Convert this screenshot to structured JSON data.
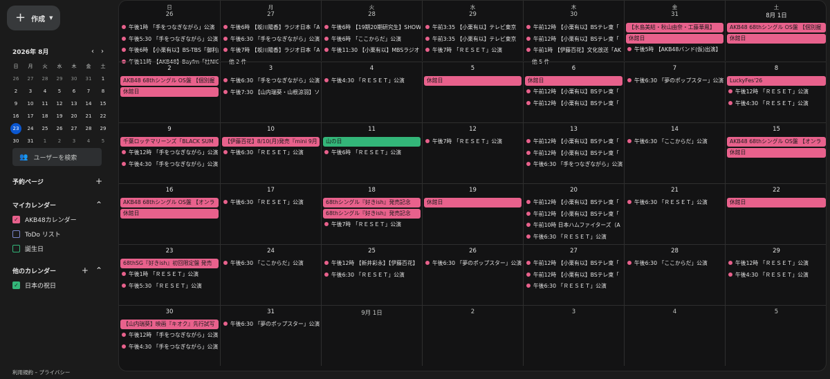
{
  "sidebar": {
    "create_label": "作成",
    "mini_title": "2026年 8月",
    "dow": [
      "日",
      "月",
      "火",
      "水",
      "木",
      "金",
      "土"
    ],
    "mini_days": [
      [
        "26",
        "27",
        "28",
        "29",
        "30",
        "31",
        "1"
      ],
      [
        "2",
        "3",
        "4",
        "5",
        "6",
        "7",
        "8"
      ],
      [
        "9",
        "10",
        "11",
        "12",
        "13",
        "14",
        "15"
      ],
      [
        "16",
        "17",
        "18",
        "19",
        "20",
        "21",
        "22"
      ],
      [
        "23",
        "24",
        "25",
        "26",
        "27",
        "28",
        "29"
      ],
      [
        "30",
        "31",
        "1",
        "2",
        "3",
        "4",
        "5"
      ]
    ],
    "search_users": "ユーザーを検索",
    "booking_pages": "予約ページ",
    "my_calendars": "マイカレンダー",
    "my_items": [
      {
        "label": "AKB48カレンダー",
        "color": "#e8618c",
        "checked": true
      },
      {
        "label": "ToDo リスト",
        "color": "#7986cb",
        "checked": false
      },
      {
        "label": "誕生日",
        "color": "#33b679",
        "checked": false
      }
    ],
    "other_calendars": "他のカレンダー",
    "other_items": [
      {
        "label": "日本の祝日",
        "color": "#33b679",
        "checked": true
      }
    ],
    "footer": "利用規約 – プライバシー"
  },
  "calendar": {
    "dow": [
      "日",
      "月",
      "火",
      "水",
      "木",
      "金",
      "土"
    ],
    "weeks": [
      [
        {
          "day": "26",
          "other": true,
          "events": [
            {
              "t": "timed",
              "text": "午後1時 「手をつなぎながら」公演"
            },
            {
              "t": "timed",
              "text": "午後5:30 「手をつなぎながら」公演"
            },
            {
              "t": "timed",
              "text": "午後6時 【小栗有以】BS-TBS「御利益"
            },
            {
              "t": "timed",
              "text": "午後11時 【AKB48】Bayfm「柱NIGHT"
            }
          ]
        },
        {
          "day": "27",
          "other": true,
          "events": [
            {
              "t": "timed",
              "text": "午後6時 【坂川陽香】ラジオ日本「AK"
            },
            {
              "t": "timed",
              "text": "午後6:30 「手をつなぎながら」公演"
            },
            {
              "t": "timed",
              "text": "午後7時 【坂川陽香】ラジオ日本「AKB"
            },
            {
              "t": "more",
              "text": "他 2 件"
            }
          ]
        },
        {
          "day": "28",
          "other": true,
          "events": [
            {
              "t": "timed",
              "text": "午後6時 【19期20期研究生】SHOW"
            },
            {
              "t": "timed",
              "text": "午後6時 「ここからだ」公演"
            },
            {
              "t": "timed",
              "text": "午後11:30 【小栗有以】MBSラジオ"
            }
          ]
        },
        {
          "day": "29",
          "other": true,
          "events": [
            {
              "t": "timed",
              "text": "午前3:35 【小栗有以】テレビ東京"
            },
            {
              "t": "timed",
              "text": "午前3:35 【小栗有以】テレビ東京"
            },
            {
              "t": "timed",
              "text": "午後7時 「ＲＥＳＥＴ」公演"
            }
          ]
        },
        {
          "day": "30",
          "other": true,
          "events": [
            {
              "t": "timed",
              "text": "午前12時 【小栗有以】BSテレ東「"
            },
            {
              "t": "timed",
              "text": "午前12時 【小栗有以】BSテレ東「"
            },
            {
              "t": "timed",
              "text": "午前1時 【伊藤百花】文化放送「AK"
            },
            {
              "t": "more",
              "text": "他 5 件"
            }
          ]
        },
        {
          "day": "31",
          "other": true,
          "events": [
            {
              "t": "allday",
              "text": "【水島美結・秋山由奈・工藤華鳳】"
            },
            {
              "t": "allday",
              "text": "休館日"
            },
            {
              "t": "timed",
              "text": "午後5時 【AKB48バンド(仮)出演】"
            }
          ]
        },
        {
          "day": "8月 1日",
          "other": false,
          "events": [
            {
              "t": "allday",
              "text": "AKB48 68thシングル OS盤 【個別握"
            },
            {
              "t": "allday",
              "text": "休館日"
            }
          ]
        }
      ],
      [
        {
          "day": "2",
          "events": [
            {
              "t": "allday",
              "text": "AKB48 68thシングル OS盤 【個別握"
            },
            {
              "t": "allday",
              "text": "休館日"
            }
          ]
        },
        {
          "day": "3",
          "events": [
            {
              "t": "timed",
              "text": "午後6:30 「手をつなぎながら」公演"
            },
            {
              "t": "timed",
              "text": "午後7:30 【山内瑞葵・山根涼羽】ソ"
            }
          ]
        },
        {
          "day": "4",
          "events": [
            {
              "t": "timed",
              "text": "午後4:30 「ＲＥＳＥＴ」公演"
            }
          ]
        },
        {
          "day": "5",
          "events": [
            {
              "t": "allday",
              "text": "休館日"
            }
          ]
        },
        {
          "day": "6",
          "events": [
            {
              "t": "allday",
              "text": "休館日"
            },
            {
              "t": "timed",
              "text": "午前12時 【小栗有以】BSテレ東「"
            },
            {
              "t": "timed",
              "text": "午前12時 【小栗有以】BSテレ東「"
            }
          ]
        },
        {
          "day": "7",
          "events": [
            {
              "t": "timed",
              "text": "午後6:30 「夢のポップスター」公演"
            }
          ]
        },
        {
          "day": "8",
          "events": [
            {
              "t": "allday",
              "text": "LuckyFes'26"
            },
            {
              "t": "timed",
              "text": "午後12時 「ＲＥＳＥＴ」公演"
            },
            {
              "t": "timed",
              "text": "午後4:30 「ＲＥＳＥＴ」公演"
            }
          ]
        }
      ],
      [
        {
          "day": "9",
          "events": [
            {
              "t": "allday",
              "text": "千葉ロッテマリーンズ「BLACK SUM"
            },
            {
              "t": "timed",
              "text": "午後12時 「手をつなぎながら」公演"
            },
            {
              "t": "timed",
              "text": "午後4:30 「手をつなぎながら」公演"
            }
          ]
        },
        {
          "day": "10",
          "events": [
            {
              "t": "allday",
              "text": "【伊藤百花】8/10(月)発売『mini 9月"
            },
            {
              "t": "timed",
              "text": "午後6:30 「ＲＥＳＥＴ」公演"
            }
          ]
        },
        {
          "day": "11",
          "events": [
            {
              "t": "allday_green",
              "text": "山の日"
            },
            {
              "t": "timed",
              "text": "午後6時 「ＲＥＳＥＴ」公演"
            }
          ]
        },
        {
          "day": "12",
          "events": [
            {
              "t": "timed",
              "text": "午後7時 「ＲＥＳＥＴ」公演"
            }
          ]
        },
        {
          "day": "13",
          "events": [
            {
              "t": "timed",
              "text": "午前12時 【小栗有以】BSテレ東「"
            },
            {
              "t": "timed",
              "text": "午前12時 【小栗有以】BSテレ東「"
            },
            {
              "t": "timed",
              "text": "午後6:30 「手をつなぎながら」公演"
            }
          ]
        },
        {
          "day": "14",
          "events": [
            {
              "t": "timed",
              "text": "午後6:30 「ここからだ」公演"
            }
          ]
        },
        {
          "day": "15",
          "events": [
            {
              "t": "allday",
              "text": "AKB48 68thシングル OS盤 【オンラ"
            },
            {
              "t": "allday",
              "text": "休館日"
            }
          ]
        }
      ],
      [
        {
          "day": "16",
          "events": [
            {
              "t": "allday",
              "text": "AKB48 68thシングル OS盤 【オンラ"
            },
            {
              "t": "allday",
              "text": "休館日"
            }
          ]
        },
        {
          "day": "17",
          "events": [
            {
              "t": "timed",
              "text": "午後6:30 「ＲＥＳＥＴ」公演"
            }
          ]
        },
        {
          "day": "18",
          "events": [
            {
              "t": "allday",
              "text": "68thシングル『好きish』発売記念"
            },
            {
              "t": "allday",
              "text": "68thシングル『好きish』発売記念"
            },
            {
              "t": "timed",
              "text": "午後7時 「ＲＥＳＥＴ」公演"
            }
          ]
        },
        {
          "day": "19",
          "events": [
            {
              "t": "allday",
              "text": "休館日"
            }
          ]
        },
        {
          "day": "20",
          "events": [
            {
              "t": "timed",
              "text": "午前12時 【小栗有以】BSテレ東「"
            },
            {
              "t": "timed",
              "text": "午前12時 【小栗有以】BSテレ東「"
            },
            {
              "t": "timed",
              "text": "午前10時 日本ハムファイターズ（A"
            },
            {
              "t": "timed",
              "text": "午後6:30 「ＲＥＳＥＴ」公演"
            }
          ]
        },
        {
          "day": "21",
          "events": [
            {
              "t": "timed",
              "text": "午後6:30 「ＲＥＳＥＴ」公演"
            }
          ]
        },
        {
          "day": "22",
          "events": [
            {
              "t": "allday",
              "text": "休館日"
            }
          ]
        }
      ],
      [
        {
          "day": "23",
          "events": [
            {
              "t": "allday",
              "text": "68thSG『好きish』初回限定盤 発売"
            },
            {
              "t": "timed",
              "text": "午後1時 「ＲＥＳＥＴ」公演"
            },
            {
              "t": "timed",
              "text": "午後5:30 「ＲＥＳＥＴ」公演"
            }
          ]
        },
        {
          "day": "24",
          "events": [
            {
              "t": "timed",
              "text": "午後6:30 「ここからだ」公演"
            }
          ]
        },
        {
          "day": "25",
          "events": [
            {
              "t": "timed",
              "text": "午後12時 【新井彩永】【伊藤百花】"
            },
            {
              "t": "timed",
              "text": "午後6:30 「ＲＥＳＥＴ」公演"
            }
          ]
        },
        {
          "day": "26",
          "events": [
            {
              "t": "timed",
              "text": "午後6:30 「夢のポップスター」公演"
            }
          ]
        },
        {
          "day": "27",
          "events": [
            {
              "t": "timed",
              "text": "午前12時 【小栗有以】BSテレ東「"
            },
            {
              "t": "timed",
              "text": "午前12時 【小栗有以】BSテレ東「"
            },
            {
              "t": "timed",
              "text": "午後6:30 「ＲＥＳＥＴ」公演"
            }
          ]
        },
        {
          "day": "28",
          "events": [
            {
              "t": "timed",
              "text": "午後6:30 「ここからだ」公演"
            }
          ]
        },
        {
          "day": "29",
          "events": [
            {
              "t": "timed",
              "text": "午後12時 「ＲＥＳＥＴ」公演"
            },
            {
              "t": "timed",
              "text": "午後4:30 「ＲＥＳＥＴ」公演"
            }
          ]
        }
      ],
      [
        {
          "day": "30",
          "events": [
            {
              "t": "allday",
              "text": "【山内瑞葵】映画『キオク』先行試写"
            },
            {
              "t": "timed",
              "text": "午後12時 「手をつなぎながら」公演"
            },
            {
              "t": "timed",
              "text": "午後4:30 「手をつなぎながら」公演"
            }
          ]
        },
        {
          "day": "31",
          "events": [
            {
              "t": "timed",
              "text": "午後6:30 「夢のポップスター」公演"
            }
          ]
        },
        {
          "day": "9月 1日",
          "other": true,
          "events": []
        },
        {
          "day": "2",
          "other": true,
          "events": []
        },
        {
          "day": "3",
          "other": true,
          "events": []
        },
        {
          "day": "4",
          "other": true,
          "events": []
        },
        {
          "day": "5",
          "other": true,
          "events": []
        }
      ]
    ]
  }
}
